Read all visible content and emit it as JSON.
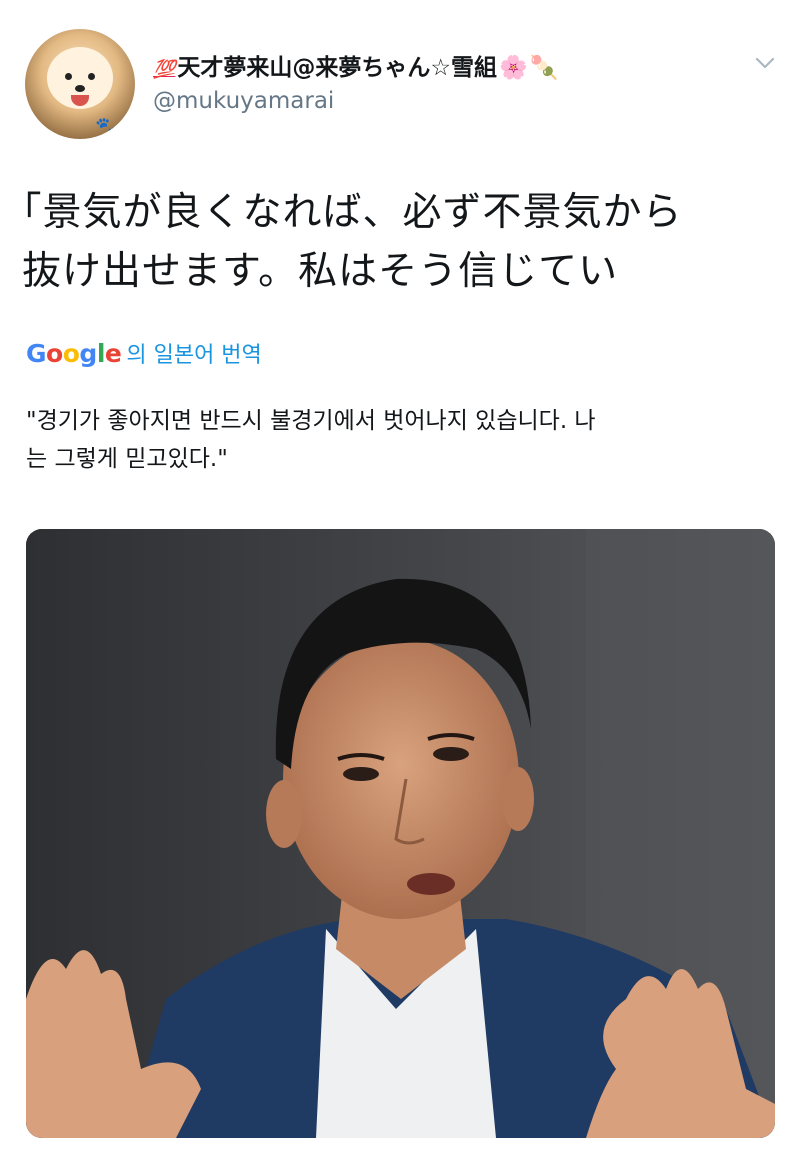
{
  "tweet": {
    "display_name": "天才夢来山@来夢ちゃん☆雪組",
    "name_emojis": {
      "prefix": "💯",
      "flower": "🌸",
      "dango": "🍡"
    },
    "handle": "@mukuyamarai",
    "text_lines": [
      "｢景気が良くなれば、必ず不景気から",
      "抜け出せます。私はそう信じてい"
    ],
    "translate_brand": [
      "G",
      "o",
      "o",
      "g",
      "l",
      "e"
    ],
    "translate_label": "의 일본어 번역",
    "translation_lines": [
      "\"경기가 좋아지면 반드시 불경기에서 벗어나지 있습니다. 나",
      "는 그렇게 믿고있다.\""
    ]
  },
  "icons": {
    "avatar": "pomeranian-avatar",
    "caret": "chevron-down-icon",
    "paw": "paw-icon"
  },
  "colors": {
    "text": "#14171a",
    "secondary": "#657786",
    "link": "#1b95e0",
    "google_blue": "#4285f4",
    "google_red": "#ea4335",
    "google_yellow": "#fbbc05",
    "google_green": "#34a853"
  }
}
